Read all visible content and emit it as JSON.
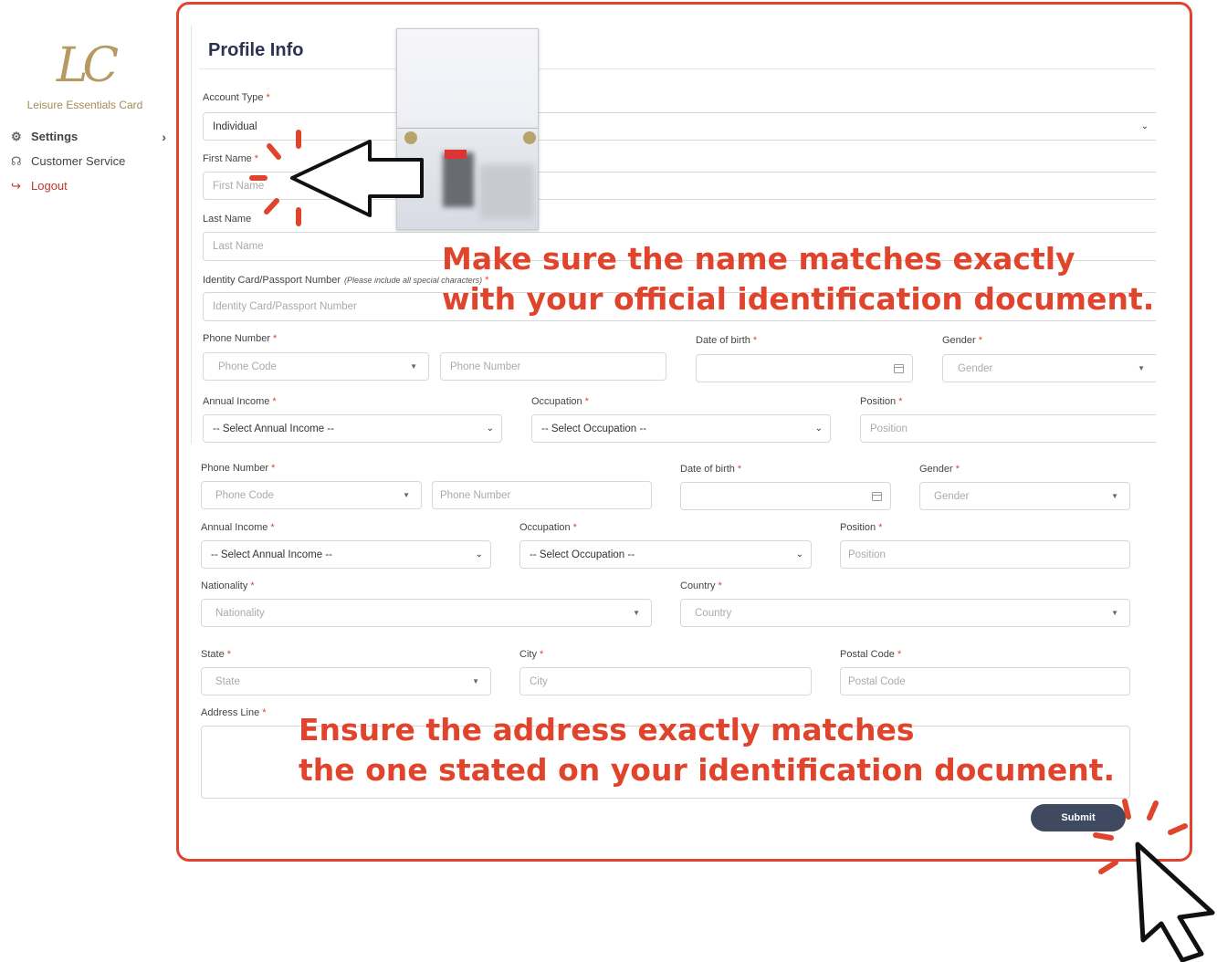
{
  "brand": {
    "logo_mark": "LC",
    "name": "Leisure Essentials Card"
  },
  "nav": {
    "settings": "Settings",
    "customer_service": "Customer Service",
    "logout": "Logout"
  },
  "page": {
    "title": "Profile Info"
  },
  "top_form": {
    "account_type_label": "Account Type",
    "account_type_value": "Individual",
    "first_name_label": "First Name",
    "first_name_placeholder": "First Name",
    "last_name_label": "Last Name",
    "last_name_placeholder": "Last Name",
    "id_label": "Identity Card/Passport Number",
    "id_note": "(Please include all special characters)",
    "id_placeholder": "Identity Card/Passport Number",
    "phone_label": "Phone Number",
    "phone_code_placeholder": "Phone Code",
    "phone_placeholder": "Phone Number",
    "dob_label": "Date of birth",
    "gender_label": "Gender",
    "gender_placeholder": "Gender",
    "income_label": "Annual Income",
    "income_value": "-- Select Annual Income --",
    "occupation_label": "Occupation",
    "occupation_value": "-- Select Occupation --",
    "position_label": "Position",
    "position_placeholder": "Position"
  },
  "bottom_form": {
    "phone_label": "Phone Number",
    "phone_code_placeholder": "Phone Code",
    "phone_placeholder": "Phone Number",
    "dob_label": "Date of birth",
    "gender_label": "Gender",
    "gender_placeholder": "Gender",
    "income_label": "Annual Income",
    "income_value": "-- Select Annual Income --",
    "occupation_label": "Occupation",
    "occupation_value": "-- Select Occupation --",
    "position_label": "Position",
    "position_placeholder": "Position",
    "nationality_label": "Nationality",
    "nationality_placeholder": "Nationality",
    "country_label": "Country",
    "country_placeholder": "Country",
    "state_label": "State",
    "state_placeholder": "State",
    "city_label": "City",
    "city_placeholder": "City",
    "postal_label": "Postal Code",
    "postal_placeholder": "Postal Code",
    "address_label": "Address Line",
    "submit_label": "Submit"
  },
  "annotations": {
    "name_line1": "Make sure the name matches exactly",
    "name_line2": "with your official identification document.",
    "address_line1": "Ensure the address exactly matches",
    "address_line2": "the one stated on your identification document."
  },
  "colors": {
    "accent": "#e0442c",
    "gold": "#b59a63",
    "button": "#3f4a60",
    "title": "#2c3350"
  },
  "required_marker": "*"
}
